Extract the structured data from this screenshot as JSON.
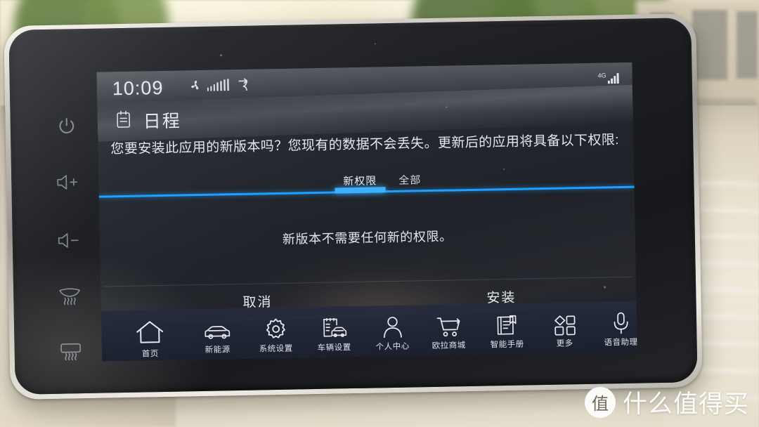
{
  "status_bar": {
    "clock": "10:09",
    "hvac_fan_icon": "fan-icon",
    "hvac_level_icon": "fan-speed-bars-icon",
    "airflow_icon": "airflow-direction-icon",
    "network_label": "4G",
    "signal_icon": "signal-bars-icon"
  },
  "app_header": {
    "icon": "calendar-icon",
    "title": "日程"
  },
  "dialog": {
    "message": "您要安装此应用的新版本吗？您现有的数据不会丢失。更新后的应用将具备以下权限:",
    "tabs": [
      {
        "label": "新权限",
        "active": true
      },
      {
        "label": "全部",
        "active": false
      }
    ],
    "body_text": "新版本不需要任何新的权限。",
    "buttons": {
      "cancel": "取消",
      "install": "安装"
    },
    "accent_color": "#1f9fff"
  },
  "dock": {
    "items": [
      {
        "label": "首页",
        "icon": "home-icon"
      },
      {
        "label": "新能源",
        "icon": "car-icon"
      },
      {
        "label": "系统设置",
        "icon": "gear-icon"
      },
      {
        "label": "车辆设置",
        "icon": "vehicle-settings-icon"
      },
      {
        "label": "个人中心",
        "icon": "person-icon"
      },
      {
        "label": "欧拉商城",
        "icon": "shopping-cart-icon"
      },
      {
        "label": "智能手册",
        "icon": "manual-book-icon"
      },
      {
        "label": "更多",
        "icon": "grid-more-icon"
      },
      {
        "label": "语音助理",
        "icon": "microphone-icon"
      }
    ]
  },
  "hardware_buttons": [
    {
      "name": "power",
      "icon": "power-icon"
    },
    {
      "name": "volume-up",
      "icon": "volume-up-icon"
    },
    {
      "name": "volume-down",
      "icon": "volume-down-icon"
    },
    {
      "name": "front-defrost",
      "icon": "front-defrost-icon"
    },
    {
      "name": "rear-defrost",
      "icon": "rear-defrost-icon"
    }
  ],
  "watermark": {
    "logo_char": "值",
    "text": "什么值得买"
  }
}
